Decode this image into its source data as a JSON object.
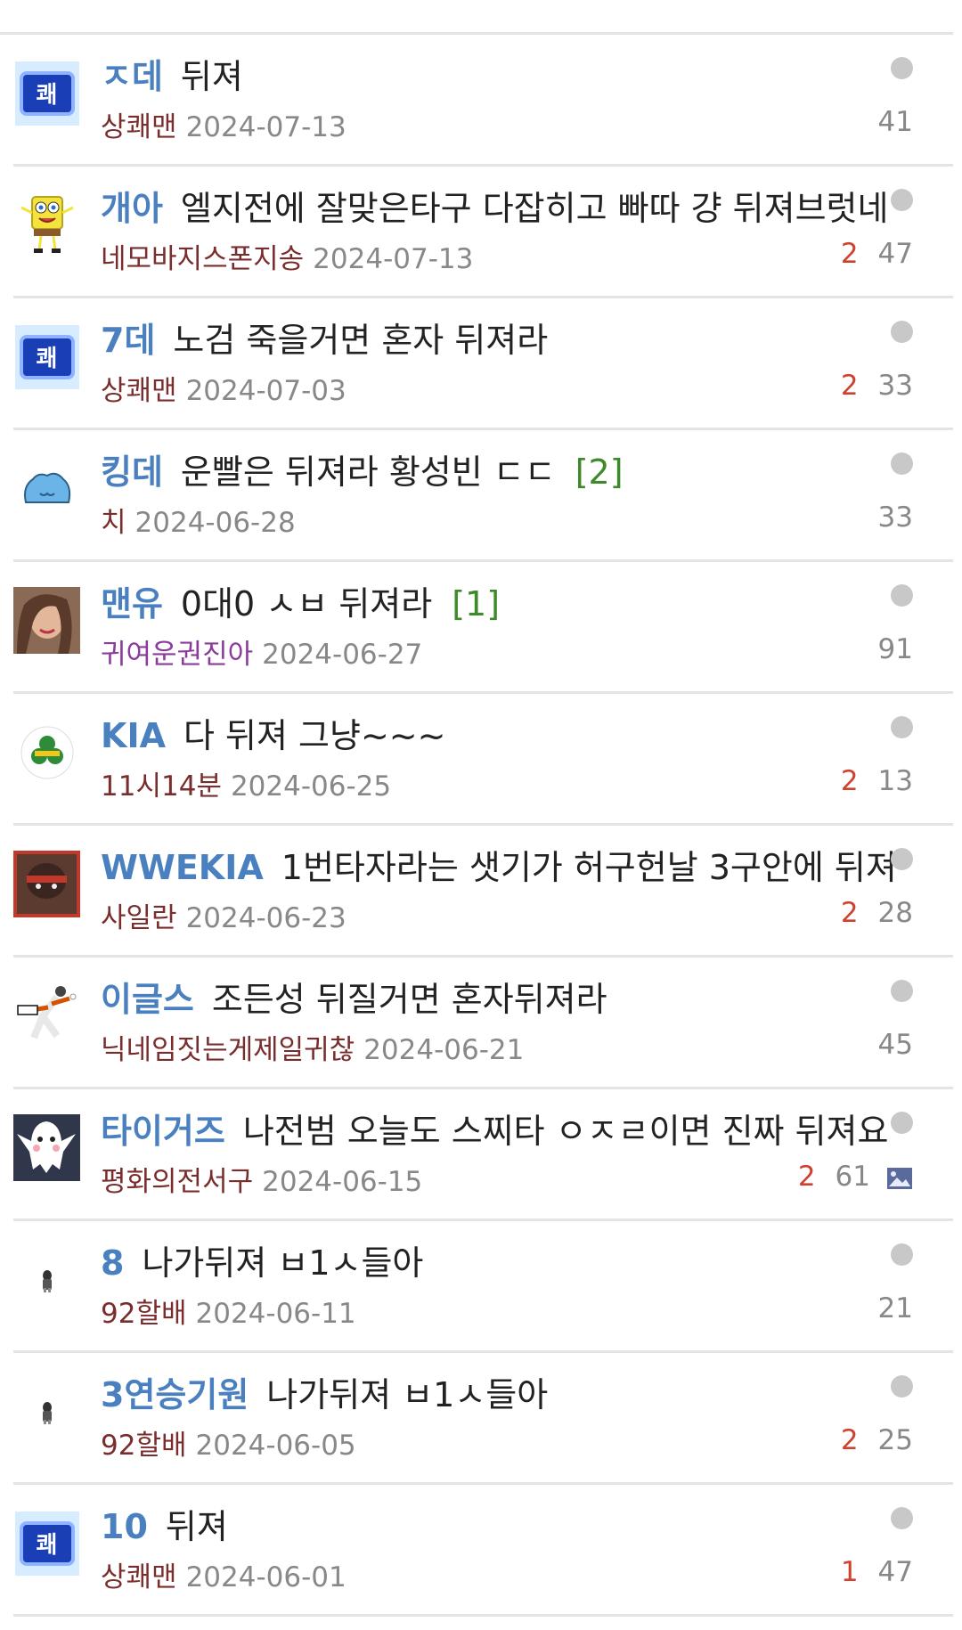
{
  "posts": [
    {
      "category": "ㅈ데",
      "title": "뒤져",
      "comments": "",
      "nickname": "상쾌맨",
      "date": "2024-07-13",
      "recommend": "",
      "views": "41",
      "avatar": "cuad",
      "has_image": false
    },
    {
      "category": "개아",
      "title": "엘지전에 잘맞은타구 다잡히고 빠따 걍 뒤져브럿네",
      "comments": "",
      "nickname": "네모바지스폰지송",
      "date": "2024-07-13",
      "recommend": "2",
      "views": "47",
      "avatar": "sponge",
      "has_image": false
    },
    {
      "category": "7데",
      "title": "노검 죽을거면 혼자 뒤져라",
      "comments": "",
      "nickname": "상쾌맨",
      "date": "2024-07-03",
      "recommend": "2",
      "views": "33",
      "avatar": "cuad",
      "has_image": false
    },
    {
      "category": "킹데",
      "title": "운빨은 뒤져라 황성빈 ㄷㄷ",
      "comments": "[2]",
      "nickname": "치",
      "date": "2024-06-28",
      "recommend": "",
      "views": "33",
      "avatar": "blob",
      "has_image": false
    },
    {
      "category": "맨유",
      "title": "0대0 ㅅㅂ 뒤져라",
      "comments": "[1]",
      "nickname": "귀여운권진아",
      "date": "2024-06-27",
      "recommend": "",
      "views": "91",
      "avatar": "photo",
      "has_image": false,
      "nick_purple": true
    },
    {
      "category": "KIA",
      "title": "다 뒤져 그냥~~~",
      "comments": "",
      "nickname": "11시14분",
      "date": "2024-06-25",
      "recommend": "2",
      "views": "13",
      "avatar": "clover",
      "has_image": false
    },
    {
      "category": "WWEKIA",
      "title": "1번타자라는 샛기가 허구헌날 3구안에 뒤져",
      "comments": "",
      "nickname": "사일란",
      "date": "2024-06-23",
      "recommend": "2",
      "views": "28",
      "avatar": "mask",
      "has_image": false
    },
    {
      "category": "이글스",
      "title": "조든성 뒤질거면 혼자뒤져라",
      "comments": "",
      "nickname": "닉네임짓는게제일귀찮",
      "date": "2024-06-21",
      "recommend": "",
      "views": "45",
      "avatar": "pitcher",
      "has_image": false
    },
    {
      "category": "타이거즈",
      "title": "나전범 오늘도 스찌타 ㅇㅈㄹ이면 진짜 뒤져요",
      "comments": "",
      "nickname": "평화의전서구",
      "date": "2024-06-15",
      "recommend": "2",
      "views": "61",
      "avatar": "ghost",
      "has_image": true
    },
    {
      "category": "8",
      "title": "나가뒤져 ㅂ1ㅅ들아",
      "comments": "",
      "nickname": "92할배",
      "date": "2024-06-11",
      "recommend": "",
      "views": "21",
      "avatar": "tiny",
      "has_image": false
    },
    {
      "category": "3연승기원",
      "title": "나가뒤져 ㅂ1ㅅ들아",
      "comments": "",
      "nickname": "92할배",
      "date": "2024-06-05",
      "recommend": "2",
      "views": "25",
      "avatar": "tiny",
      "has_image": false
    },
    {
      "category": "10",
      "title": "뒤져",
      "comments": "",
      "nickname": "상쾌맨",
      "date": "2024-06-01",
      "recommend": "1",
      "views": "47",
      "avatar": "cuad",
      "has_image": false
    }
  ],
  "avatar_label_cuad": "쾌",
  "colors": {
    "category": "#4a80c0",
    "nickname": "#7a2d2d",
    "recommend": "#d0412f",
    "comment_count": "#3d8a2a",
    "divider": "#e4e4e4"
  }
}
